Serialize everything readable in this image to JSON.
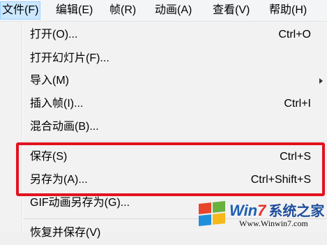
{
  "menubar": {
    "items": [
      {
        "label": "文件(F)",
        "active": true
      },
      {
        "label": "编辑(E)"
      },
      {
        "label": "帧(R)"
      },
      {
        "label": "动画(A)"
      },
      {
        "label": "查看(V)"
      },
      {
        "label": "帮助(H)"
      }
    ]
  },
  "file_menu": {
    "items": [
      {
        "label": "打开(O)...",
        "shortcut": "Ctrl+O"
      },
      {
        "label": "打开幻灯片(F)...",
        "shortcut": ""
      },
      {
        "label": "导入(M)",
        "shortcut": "",
        "submenu": true
      },
      {
        "label": "插入帧(I)...",
        "shortcut": "Ctrl+I"
      },
      {
        "label": "混合动画(B)...",
        "shortcut": ""
      },
      {
        "label": "保存(S)",
        "shortcut": "Ctrl+S"
      },
      {
        "label": "另存为(A)...",
        "shortcut": "Ctrl+Shift+S"
      },
      {
        "label": "GIF动画另存为(G)...",
        "shortcut": ""
      },
      {
        "label": "恢复并保存(V)",
        "shortcut": ""
      }
    ]
  },
  "watermark": {
    "brand_prefix": "Win",
    "brand_seven": "7",
    "brand_cn": "系统之家",
    "url": "Www.Winwin7.com"
  },
  "colors": {
    "highlight_border": "#e1131f",
    "menu_active_bg": "#cce8ff",
    "brand_blue": "#1d5fb3"
  }
}
